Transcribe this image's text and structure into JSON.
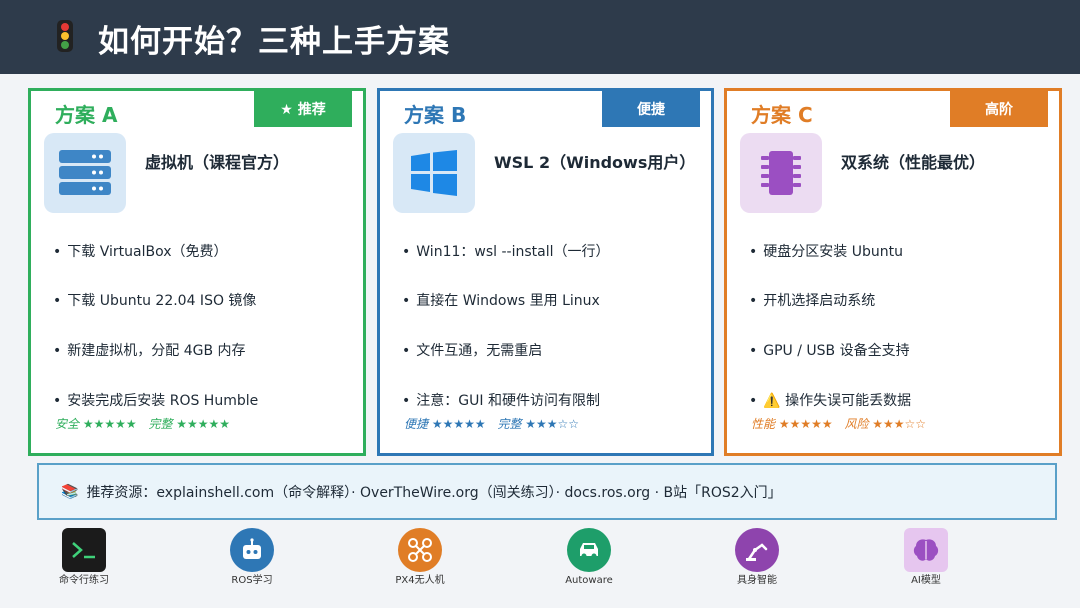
{
  "header": {
    "title": "如何开始？三种上手方案",
    "icon": "traffic-light-icon"
  },
  "plans": [
    {
      "name": "方案 A",
      "badge": "★ 推荐",
      "icon": "server-icon",
      "subtitle": "虚拟机（课程官方）",
      "bullets": [
        "下载 VirtualBox（免费）",
        "下载 Ubuntu 22.04 ISO 镜像",
        "新建虚拟机，分配 4GB 内存",
        "安装完成后安装 ROS Humble"
      ],
      "ratings": [
        "安全 ★★★★★",
        "完整 ★★★★★"
      ],
      "color": "#2fae5c"
    },
    {
      "name": "方案 B",
      "badge": "便捷",
      "icon": "windows-icon",
      "subtitle": "WSL 2（Windows用户）",
      "bullets": [
        "Win11：wsl --install（一行）",
        "直接在 Windows 里用 Linux",
        "文件互通，无需重启",
        "注意：GUI 和硬件访问有限制"
      ],
      "ratings": [
        "便捷 ★★★★★",
        "完整 ★★★☆☆"
      ],
      "color": "#2e77b5"
    },
    {
      "name": "方案 C",
      "badge": "高阶",
      "icon": "chip-icon",
      "subtitle": "双系统（性能最优）",
      "bullets": [
        "硬盘分区安装 Ubuntu",
        "开机选择启动系统",
        "GPU / USB 设备全支持",
        "⚠️ 操作失误可能丢数据"
      ],
      "ratings": [
        "性能 ★★★★★",
        "风险 ★★★☆☆"
      ],
      "color": "#e07d26"
    }
  ],
  "resources": {
    "icon": "books-icon",
    "text": "推荐资源：explainshell.com（命令解释）· OverTheWire.org（闯关练习）· docs.ros.org · B站「ROS2入门」"
  },
  "dock": [
    {
      "label": "命令行练习",
      "icon": "terminal-icon",
      "color": "#1b1b1b"
    },
    {
      "label": "ROS学习",
      "icon": "robot-icon",
      "color": "#2e77b5"
    },
    {
      "label": "PX4无人机",
      "icon": "drone-icon",
      "color": "#e07d26"
    },
    {
      "label": "Autoware",
      "icon": "car-icon",
      "color": "#1e9e6a"
    },
    {
      "label": "具身智能",
      "icon": "robot-arm-icon",
      "color": "#8e44ad"
    },
    {
      "label": "AI模型",
      "icon": "brain-icon",
      "color": "#e6c6ef"
    }
  ]
}
